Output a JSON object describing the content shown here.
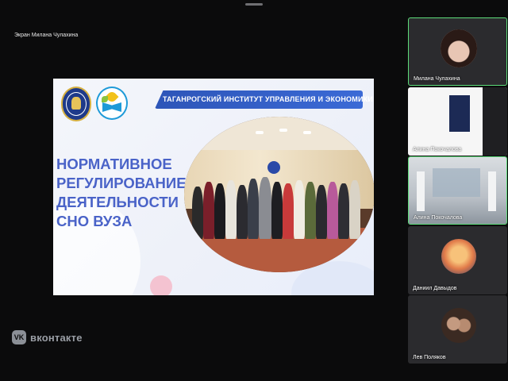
{
  "screen_share": {
    "owner_label": "Экран Милана Чулахина"
  },
  "slide": {
    "banner": "ТАГАНРОГСКИЙ ИНСТИТУТ УПРАВЛЕНИЯ И ЭКОНОМИКИ",
    "heading_lines": [
      "НОРМАТИВНОЕ",
      "РЕГУЛИРОВАНИЕ",
      "ДЕЯТЕЛЬНОСТИ",
      "СНО ВУЗА"
    ]
  },
  "participants": [
    {
      "name": "Милана Чулахина"
    },
    {
      "name": "Алина Покочалова"
    },
    {
      "name": "Алина Покочалова"
    },
    {
      "name": "Даниил Давыдов"
    },
    {
      "name": "Лев Поляков"
    }
  ],
  "brand": {
    "icon": "vk-logo-icon",
    "name": "вконтакте",
    "icon_glyph": "VK"
  },
  "colors": {
    "active_speaker_border": "#5ddc7a",
    "slide_heading": "#4a63c8",
    "banner": "#2d55b8"
  }
}
